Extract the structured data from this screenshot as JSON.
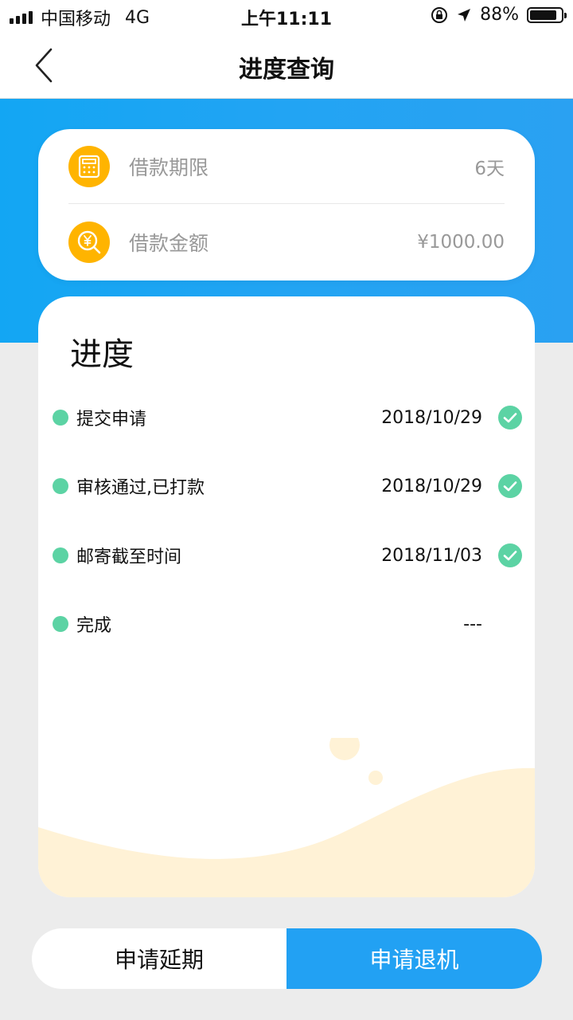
{
  "status_bar": {
    "carrier": "中国移动",
    "network": "4G",
    "time": "上午11:11",
    "battery_percent": "88%",
    "battery_level": 0.88
  },
  "nav": {
    "title": "进度查询",
    "back_icon": "chevron-left-icon"
  },
  "loan": {
    "term_label": "借款期限",
    "term_value": "6天",
    "term_icon": "calculator-icon",
    "amount_label": "借款金额",
    "amount_value": "¥1000.00",
    "amount_icon": "yen-search-icon"
  },
  "progress": {
    "title": "进度",
    "steps": [
      {
        "label": "提交申请",
        "date": "2018/10/29",
        "done": true
      },
      {
        "label": "审核通过,已打款",
        "date": "2018/10/29",
        "done": true
      },
      {
        "label": "邮寄截至时间",
        "date": "2018/11/03",
        "done": true
      },
      {
        "label": "完成",
        "date": "---",
        "done": false
      }
    ]
  },
  "actions": {
    "extend_label": "申请延期",
    "return_label": "申请退机"
  },
  "colors": {
    "accent_blue": "#22a1f3",
    "icon_yellow": "#ffb400",
    "step_green": "#5cd3a4",
    "wave_cream": "#fff2d6"
  }
}
